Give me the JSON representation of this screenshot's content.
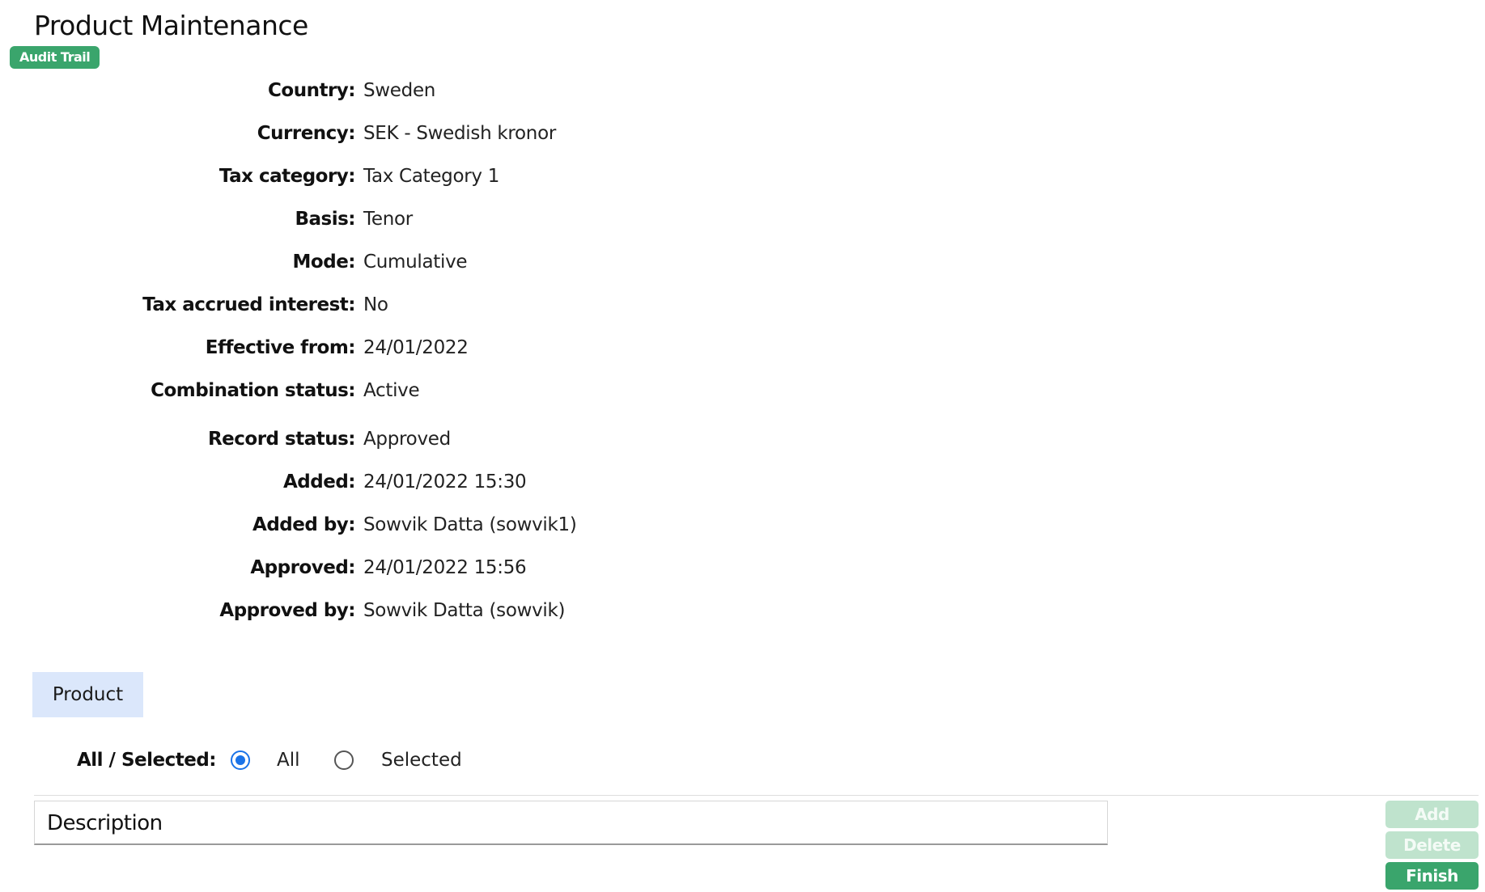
{
  "page": {
    "title": "Product Maintenance",
    "audit_trail_label": "Audit Trail"
  },
  "details": [
    {
      "label": "Country:",
      "value": "Sweden"
    },
    {
      "label": "Currency:",
      "value": "SEK - Swedish kronor"
    },
    {
      "label": "Tax category:",
      "value": "Tax Category 1"
    },
    {
      "label": "Basis:",
      "value": "Tenor"
    },
    {
      "label": "Mode:",
      "value": "Cumulative"
    },
    {
      "label": "Tax accrued interest:",
      "value": "No"
    },
    {
      "label": "Effective from:",
      "value": "24/01/2022"
    },
    {
      "label": "Combination status:",
      "value": "Active"
    },
    {
      "label": "Record status:",
      "value": "Approved"
    },
    {
      "label": "Added:",
      "value": "24/01/2022 15:30"
    },
    {
      "label": "Added by:",
      "value": "Sowvik Datta (sowvik1)"
    },
    {
      "label": "Approved:",
      "value": "24/01/2022 15:56"
    },
    {
      "label": "Approved by:",
      "value": "Sowvik Datta (sowvik)"
    }
  ],
  "tabs": [
    {
      "label": "Product",
      "active": true
    }
  ],
  "selector": {
    "label": "All / Selected:",
    "options": [
      {
        "label": "All",
        "checked": true
      },
      {
        "label": "Selected",
        "checked": false
      }
    ]
  },
  "table": {
    "columns": [
      "Description"
    ],
    "rows": []
  },
  "actions": {
    "add_label": "Add",
    "delete_label": "Delete",
    "finish_label": "Finish"
  },
  "colors": {
    "accent_green": "#3aa56c",
    "disabled_green": "#bfe3cd",
    "tab_active_bg": "#dbe7fb",
    "radio_blue": "#1a73e8"
  }
}
